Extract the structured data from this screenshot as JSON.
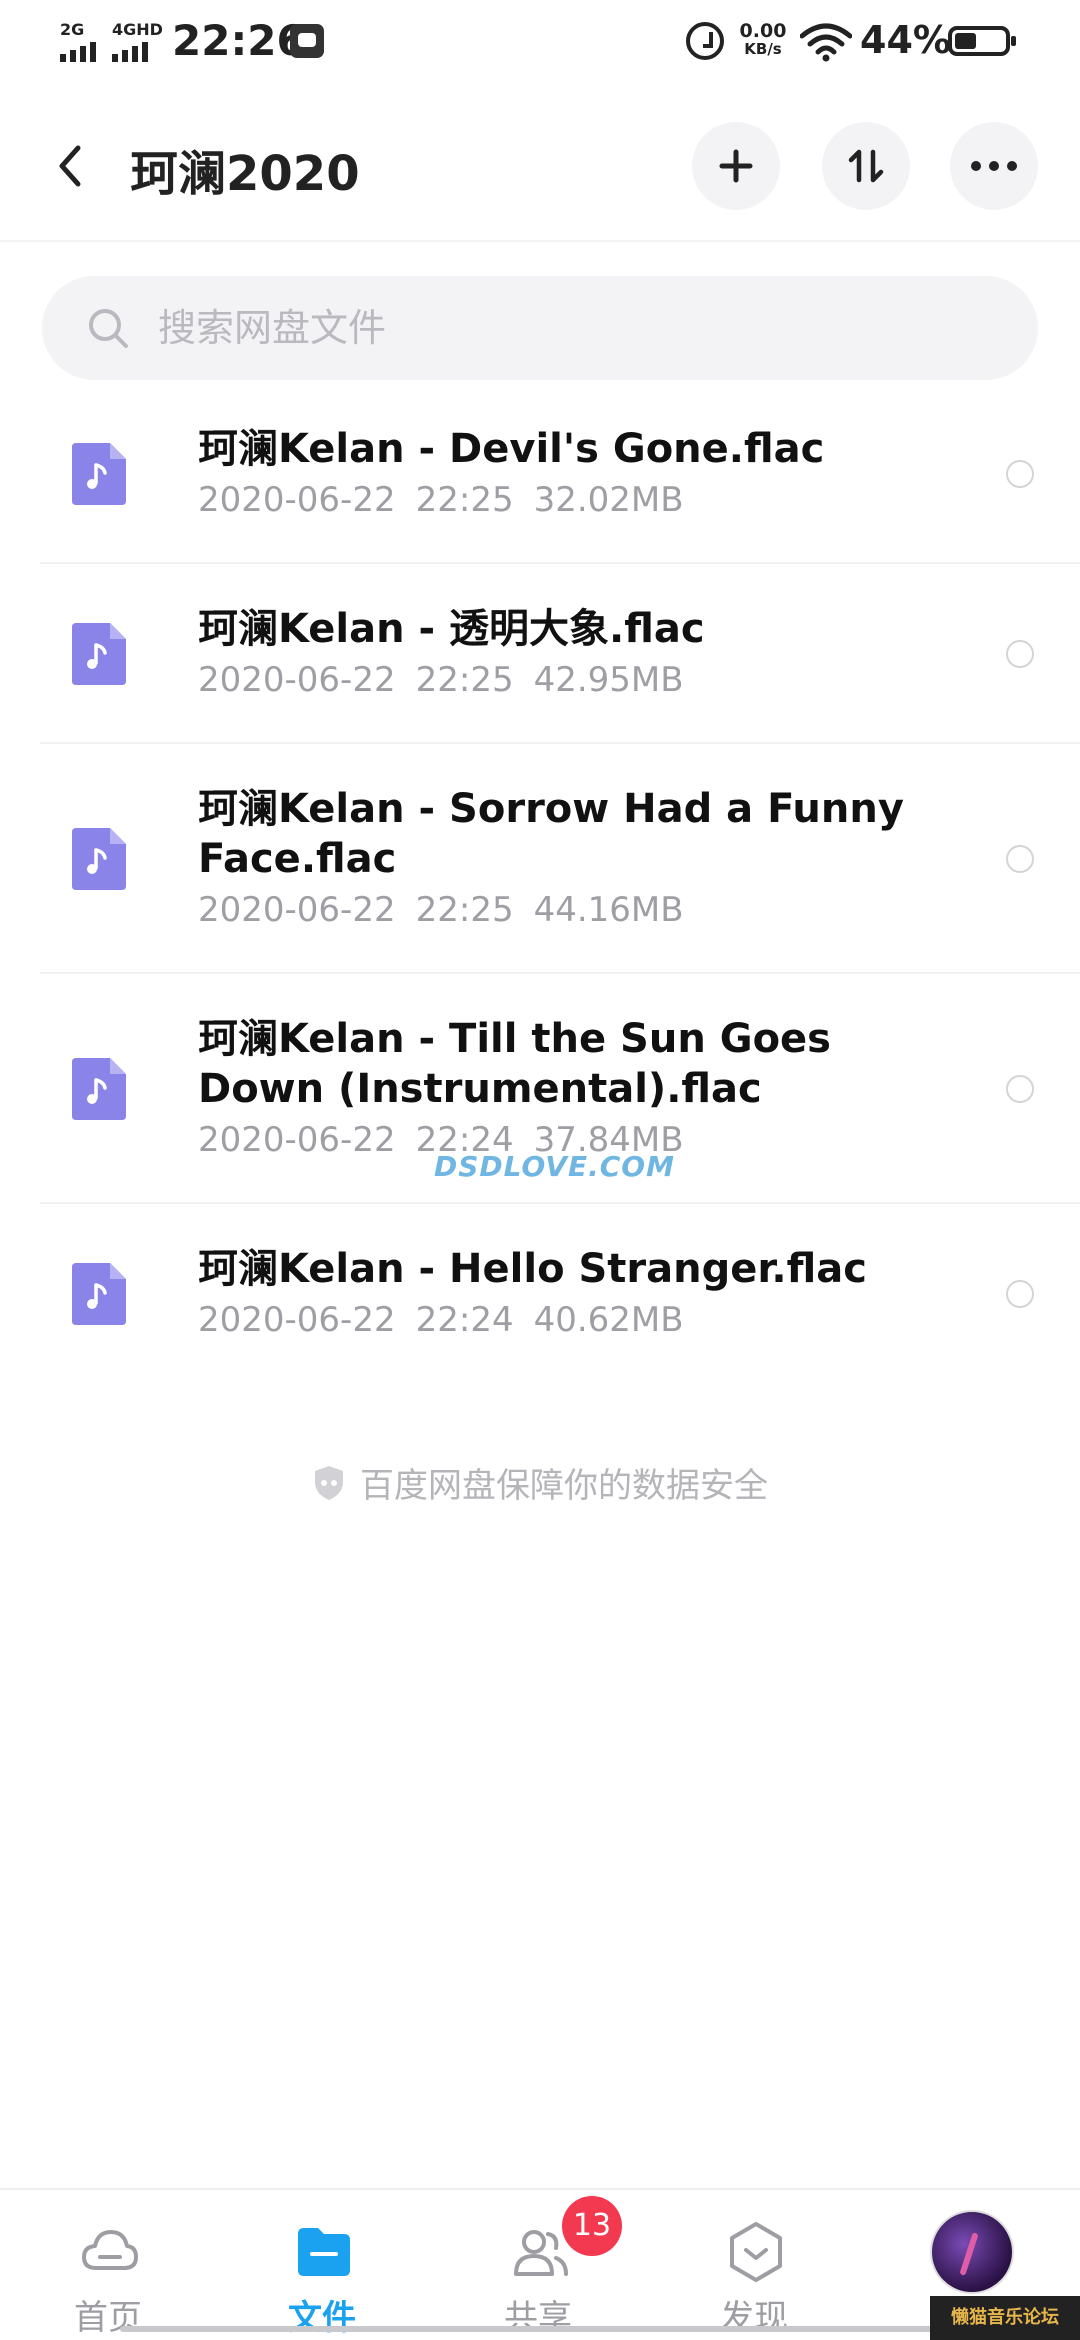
{
  "status_bar": {
    "signal1_tag": "2G",
    "signal2_tag": "4GHD",
    "time": "22:26",
    "net_speed_value": "0.00",
    "net_speed_unit": "KB/s",
    "battery_percent": "44%",
    "battery_level": 0.44
  },
  "header": {
    "title": "珂澜2020"
  },
  "search": {
    "placeholder": "搜索网盘文件"
  },
  "files": [
    {
      "name": "珂澜Kelan - Devil's Gone.flac",
      "date": "2020-06-22",
      "time": "22:25",
      "size": "32.02MB"
    },
    {
      "name": "珂澜Kelan - 透明大象.flac",
      "date": "2020-06-22",
      "time": "22:25",
      "size": "42.95MB"
    },
    {
      "name": "珂澜Kelan - Sorrow Had a Funny Face.flac",
      "date": "2020-06-22",
      "time": "22:25",
      "size": "44.16MB"
    },
    {
      "name": "珂澜Kelan - Till the Sun Goes Down (Instrumental).flac",
      "date": "2020-06-22",
      "time": "22:24",
      "size": "37.84MB"
    },
    {
      "name": "珂澜Kelan - Hello Stranger.flac",
      "date": "2020-06-22",
      "time": "22:24",
      "size": "40.62MB"
    }
  ],
  "security_note": "百度网盘保障你的数据安全",
  "watermark": "DSDLOVE.COM",
  "bottom_nav": {
    "home": "首页",
    "files": "文件",
    "share": "共享",
    "discover": "发现",
    "share_badge": "13"
  },
  "forum_tag": "懒猫音乐论坛",
  "colors": {
    "accent": "#1aa1f0",
    "file_icon": "#8a84e8",
    "badge": "#f2394f",
    "meta_text": "#9e9ea4"
  },
  "icons": {
    "back": "chevron-left-icon",
    "add": "plus-icon",
    "sort": "sort-arrows-icon",
    "more": "more-dots-icon",
    "search": "search-icon",
    "file": "music-file-icon",
    "shield": "shield-icon"
  }
}
